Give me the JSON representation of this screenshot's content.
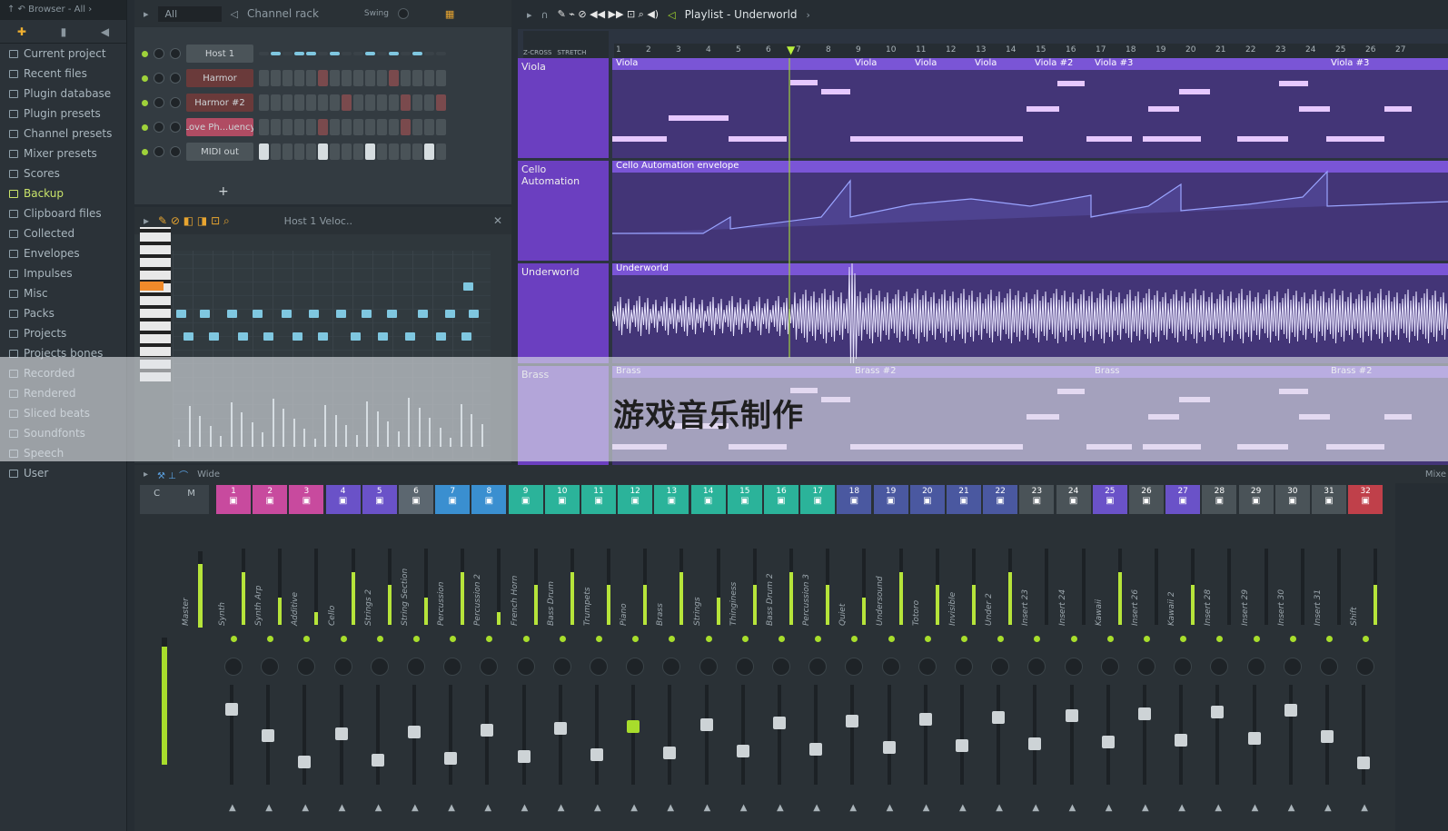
{
  "browser": {
    "path": "Browser - All",
    "items": [
      "Current project",
      "Recent files",
      "Plugin database",
      "Plugin presets",
      "Channel presets",
      "Mixer presets",
      "Scores",
      "Backup",
      "Clipboard files",
      "Collected",
      "Envelopes",
      "Impulses",
      "Misc",
      "Packs",
      "Projects",
      "Projects bones",
      "Recorded",
      "Rendered",
      "Sliced beats",
      "Soundfonts",
      "Speech",
      "User"
    ],
    "highlighted": "Backup"
  },
  "channel_rack": {
    "filter": "All",
    "title": "Channel rack",
    "swing_label": "Swing",
    "channels": [
      {
        "name": "Host 1",
        "style": "gray"
      },
      {
        "name": "Harmor",
        "style": "red"
      },
      {
        "name": "Harmor #2",
        "style": "red"
      },
      {
        "name": "Love Ph...uency",
        "style": "pink"
      },
      {
        "name": "MIDI out",
        "style": "gray"
      }
    ],
    "add_label": "+"
  },
  "piano_roll": {
    "title": "Host 1  Veloc.."
  },
  "playlist": {
    "title": "Playlist - Underworld",
    "snap_labels": [
      "Z-CROSS",
      "STRETCH"
    ],
    "ruler": [
      "1",
      "2",
      "3",
      "4",
      "5",
      "6",
      "7",
      "8",
      "9",
      "10",
      "11",
      "12",
      "13",
      "14",
      "15",
      "16",
      "17",
      "18",
      "19",
      "20",
      "21",
      "22",
      "23",
      "24",
      "25",
      "26",
      "27"
    ],
    "tracks": [
      {
        "name": "Viola",
        "clips": [
          "Viola",
          "Viola",
          "Viola",
          "Viola",
          "Viola #2",
          "Viola #3",
          "Viola #3"
        ]
      },
      {
        "name": "Cello Automation",
        "clips": [
          "Cello Automation envelope"
        ]
      },
      {
        "name": "Underworld",
        "clips": [
          "Underworld"
        ]
      },
      {
        "name": "Brass",
        "clips": [
          "Brass",
          "Brass #2",
          "Brass",
          "Brass #2"
        ]
      }
    ]
  },
  "mixer": {
    "title": "Wide",
    "master_labels": [
      "C",
      "M"
    ],
    "inserts": [
      {
        "num": "1",
        "name": "Synth",
        "color": "#c84a9e"
      },
      {
        "num": "2",
        "name": "Synth Arp",
        "color": "#c84a9e"
      },
      {
        "num": "3",
        "name": "Additive",
        "color": "#c84a9e"
      },
      {
        "num": "4",
        "name": "Cello",
        "color": "#6a52c8"
      },
      {
        "num": "5",
        "name": "Strings 2",
        "color": "#6a52c8"
      },
      {
        "num": "6",
        "name": "String Section",
        "color": "#5c6770"
      },
      {
        "num": "7",
        "name": "Percussion",
        "color": "#3a8fd0"
      },
      {
        "num": "8",
        "name": "Percussion 2",
        "color": "#3a8fd0"
      },
      {
        "num": "9",
        "name": "French Horn",
        "color": "#2bb39a"
      },
      {
        "num": "10",
        "name": "Bass Drum",
        "color": "#2bb39a"
      },
      {
        "num": "11",
        "name": "Trumpets",
        "color": "#2bb39a"
      },
      {
        "num": "12",
        "name": "Piano",
        "color": "#2bb39a"
      },
      {
        "num": "13",
        "name": "Brass",
        "color": "#2bb39a"
      },
      {
        "num": "14",
        "name": "Strings",
        "color": "#2bb39a"
      },
      {
        "num": "15",
        "name": "Thinginess",
        "color": "#2bb39a"
      },
      {
        "num": "16",
        "name": "Bass Drum 2",
        "color": "#2bb39a"
      },
      {
        "num": "17",
        "name": "Percussion 3",
        "color": "#2bb39a"
      },
      {
        "num": "18",
        "name": "Quiet",
        "color": "#4a58a0"
      },
      {
        "num": "19",
        "name": "Undersound",
        "color": "#4a58a0"
      },
      {
        "num": "20",
        "name": "Totoro",
        "color": "#4a58a0"
      },
      {
        "num": "21",
        "name": "Invisible",
        "color": "#4a58a0"
      },
      {
        "num": "22",
        "name": "Under 2",
        "color": "#4a58a0"
      },
      {
        "num": "23",
        "name": "Insert 23",
        "color": "#4a5358"
      },
      {
        "num": "24",
        "name": "Insert 24",
        "color": "#4a5358"
      },
      {
        "num": "25",
        "name": "Kawaii",
        "color": "#6a52c8"
      },
      {
        "num": "26",
        "name": "Insert 26",
        "color": "#4a5358"
      },
      {
        "num": "27",
        "name": "Kawaii 2",
        "color": "#6a52c8"
      },
      {
        "num": "28",
        "name": "Insert 28",
        "color": "#4a5358"
      },
      {
        "num": "29",
        "name": "Insert 29",
        "color": "#4a5358"
      },
      {
        "num": "30",
        "name": "Insert 30",
        "color": "#4a5358"
      },
      {
        "num": "31",
        "name": "Insert 31",
        "color": "#4a5358"
      },
      {
        "num": "32",
        "name": "Shift",
        "color": "#c0404a"
      }
    ],
    "master_name": "Master",
    "right_label": "Mixe"
  },
  "overlay_title": "游戏音乐制作"
}
